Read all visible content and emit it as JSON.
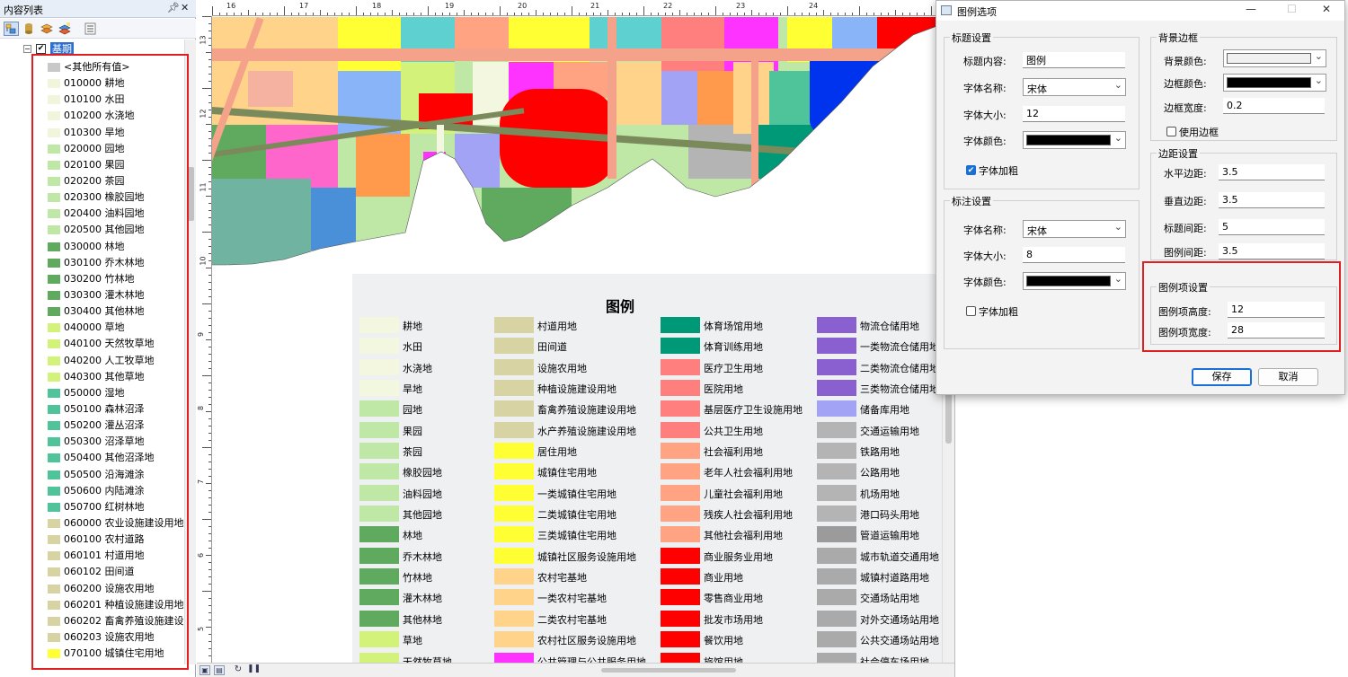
{
  "toc": {
    "title": "内容列表",
    "pin_icon": "pin-icon",
    "close_icon": "close-icon",
    "root_layer": "基期",
    "items": [
      {
        "label": "<其他所有值>",
        "color": "#c8c8c8"
      },
      {
        "label": "010000 耕地",
        "color": "#f0f5dc"
      },
      {
        "label": "010100 水田",
        "color": "#f0f5dc"
      },
      {
        "label": "010200 水浇地",
        "color": "#f0f5dc"
      },
      {
        "label": "010300 旱地",
        "color": "#f0f5dc"
      },
      {
        "label": "020000 园地",
        "color": "#bfe7a6"
      },
      {
        "label": "020100 果园",
        "color": "#bfe7a6"
      },
      {
        "label": "020200 茶园",
        "color": "#bfe7a6"
      },
      {
        "label": "020300 橡胶园地",
        "color": "#bfe7a6"
      },
      {
        "label": "020400 油料园地",
        "color": "#bfe7a6"
      },
      {
        "label": "020500 其他园地",
        "color": "#bfe7a6"
      },
      {
        "label": "030000 林地",
        "color": "#5faa5f"
      },
      {
        "label": "030100 乔木林地",
        "color": "#5faa5f"
      },
      {
        "label": "030200 竹林地",
        "color": "#5faa5f"
      },
      {
        "label": "030300 灌木林地",
        "color": "#5faa5f"
      },
      {
        "label": "030400 其他林地",
        "color": "#5faa5f"
      },
      {
        "label": "040000 草地",
        "color": "#d2f27a"
      },
      {
        "label": "040100 天然牧草地",
        "color": "#d2f27a"
      },
      {
        "label": "040200 人工牧草地",
        "color": "#d2f27a"
      },
      {
        "label": "040300 其他草地",
        "color": "#d2f27a"
      },
      {
        "label": "050000 湿地",
        "color": "#4fc49a"
      },
      {
        "label": "050100 森林沼泽",
        "color": "#4fc49a"
      },
      {
        "label": "050200 灌丛沼泽",
        "color": "#4fc49a"
      },
      {
        "label": "050300 沼泽草地",
        "color": "#4fc49a"
      },
      {
        "label": "050400 其他沼泽地",
        "color": "#4fc49a"
      },
      {
        "label": "050500 沿海滩涂",
        "color": "#4fc49a"
      },
      {
        "label": "050600 内陆滩涂",
        "color": "#4fc49a"
      },
      {
        "label": "050700 红树林地",
        "color": "#4fc49a"
      },
      {
        "label": "060000 农业设施建设用地",
        "color": "#d8d3a3"
      },
      {
        "label": "060100 农村道路",
        "color": "#d8d3a3"
      },
      {
        "label": "060101 村道用地",
        "color": "#d8d3a3"
      },
      {
        "label": "060102 田间道",
        "color": "#d8d3a3"
      },
      {
        "label": "060200 设施农用地",
        "color": "#d8d3a3"
      },
      {
        "label": "060201 种植设施建设用地",
        "color": "#d8d3a3"
      },
      {
        "label": "060202 畜禽养殖设施建设",
        "color": "#d8d3a3"
      },
      {
        "label": "060203 设施农用地",
        "color": "#d8d3a3"
      },
      {
        "label": "070100 城镇住宅用地",
        "color": "#ffff33"
      }
    ]
  },
  "ruler": {
    "top": [
      "16",
      "17",
      "18",
      "19",
      "20",
      "21",
      "22",
      "23",
      "24"
    ],
    "left": [
      "13",
      "12",
      "11",
      "10",
      "9",
      "8",
      "7",
      "6",
      "5"
    ]
  },
  "legend": {
    "title": "图例",
    "columns": [
      [
        {
          "label": "耕地",
          "color": "#f3f7e0"
        },
        {
          "label": "水田",
          "color": "#f3f7e0"
        },
        {
          "label": "水浇地",
          "color": "#f3f7e0"
        },
        {
          "label": "旱地",
          "color": "#f3f7e0"
        },
        {
          "label": "园地",
          "color": "#bfe7a6"
        },
        {
          "label": "果园",
          "color": "#bfe7a6"
        },
        {
          "label": "茶园",
          "color": "#bfe7a6"
        },
        {
          "label": "橡胶园地",
          "color": "#bfe7a6"
        },
        {
          "label": "油料园地",
          "color": "#bfe7a6"
        },
        {
          "label": "其他园地",
          "color": "#bfe7a6"
        },
        {
          "label": "林地",
          "color": "#5faa5f"
        },
        {
          "label": "乔木林地",
          "color": "#5faa5f"
        },
        {
          "label": "竹林地",
          "color": "#5faa5f"
        },
        {
          "label": "灌木林地",
          "color": "#5faa5f"
        },
        {
          "label": "其他林地",
          "color": "#5faa5f"
        },
        {
          "label": "草地",
          "color": "#d2f27a"
        },
        {
          "label": "天然牧草地",
          "color": "#d2f27a"
        }
      ],
      [
        {
          "label": "村道用地",
          "color": "#d8d3a3"
        },
        {
          "label": "田间道",
          "color": "#d8d3a3"
        },
        {
          "label": "设施农用地",
          "color": "#d8d3a3"
        },
        {
          "label": "种植设施建设用地",
          "color": "#d8d3a3"
        },
        {
          "label": "畜禽养殖设施建设用地",
          "color": "#d8d3a3"
        },
        {
          "label": "水产养殖设施建设用地",
          "color": "#d8d3a3"
        },
        {
          "label": "居住用地",
          "color": "#ffff33"
        },
        {
          "label": "城镇住宅用地",
          "color": "#ffff33"
        },
        {
          "label": "一类城镇住宅用地",
          "color": "#ffff33"
        },
        {
          "label": "二类城镇住宅用地",
          "color": "#ffff33"
        },
        {
          "label": "三类城镇住宅用地",
          "color": "#ffff33"
        },
        {
          "label": "城镇社区服务设施用地",
          "color": "#ffff33"
        },
        {
          "label": "农村宅基地",
          "color": "#ffd38a"
        },
        {
          "label": "一类农村宅基地",
          "color": "#ffd38a"
        },
        {
          "label": "二类农村宅基地",
          "color": "#ffd38a"
        },
        {
          "label": "农村社区服务设施用地",
          "color": "#ffd38a"
        },
        {
          "label": "公共管理与公共服务用地",
          "color": "#ff33ff"
        }
      ],
      [
        {
          "label": "体育场馆用地",
          "color": "#009977"
        },
        {
          "label": "体育训练用地",
          "color": "#009977"
        },
        {
          "label": "医疗卫生用地",
          "color": "#ff7f7f"
        },
        {
          "label": "医院用地",
          "color": "#ff7f7f"
        },
        {
          "label": "基层医疗卫生设施用地",
          "color": "#ff7f7f"
        },
        {
          "label": "公共卫生用地",
          "color": "#ff7f7f"
        },
        {
          "label": "社会福利用地",
          "color": "#ffa383"
        },
        {
          "label": "老年人社会福利用地",
          "color": "#ffa383"
        },
        {
          "label": "儿童社会福利用地",
          "color": "#ffa383"
        },
        {
          "label": "残疾人社会福利用地",
          "color": "#ffa383"
        },
        {
          "label": "其他社会福利用地",
          "color": "#ffa383"
        },
        {
          "label": "商业服务业用地",
          "color": "#ff0000"
        },
        {
          "label": "商业用地",
          "color": "#ff0000"
        },
        {
          "label": "零售商业用地",
          "color": "#ff0000"
        },
        {
          "label": "批发市场用地",
          "color": "#ff0000"
        },
        {
          "label": "餐饮用地",
          "color": "#ff0000"
        },
        {
          "label": "旅馆用地",
          "color": "#ff0000"
        }
      ],
      [
        {
          "label": "物流仓储用地",
          "color": "#8a5fd0"
        },
        {
          "label": "一类物流仓储用地",
          "color": "#8a5fd0"
        },
        {
          "label": "二类物流仓储用地",
          "color": "#8a5fd0"
        },
        {
          "label": "三类物流仓储用地",
          "color": "#8a5fd0"
        },
        {
          "label": "储备库用地",
          "color": "#a3a3f5"
        },
        {
          "label": "交通运输用地",
          "color": "#b4b4b4"
        },
        {
          "label": "铁路用地",
          "color": "#b4b4b4"
        },
        {
          "label": "公路用地",
          "color": "#b4b4b4"
        },
        {
          "label": "机场用地",
          "color": "#b4b4b4"
        },
        {
          "label": "港口码头用地",
          "color": "#b4b4b4"
        },
        {
          "label": "管道运输用地",
          "color": "#9b9b9b"
        },
        {
          "label": "城市轨道交通用地",
          "color": "#aaaaaa"
        },
        {
          "label": "城镇村道路用地",
          "color": "#aaaaaa"
        },
        {
          "label": "交通场站用地",
          "color": "#aaaaaa"
        },
        {
          "label": "对外交通场站用地",
          "color": "#aaaaaa"
        },
        {
          "label": "公共交通场站用地",
          "color": "#aaaaaa"
        },
        {
          "label": "社会停车场用地",
          "color": "#aaaaaa"
        }
      ]
    ]
  },
  "dialog": {
    "title": "图例选项",
    "title_group": {
      "label": "标题设置",
      "content_label": "标题内容:",
      "content_value": "图例",
      "font_name_label": "字体名称:",
      "font_name_value": "宋体",
      "font_size_label": "字体大小:",
      "font_size_value": "12",
      "font_color_label": "字体颜色:",
      "font_color": "#000000",
      "bold_label": "字体加粗",
      "bold_checked": true
    },
    "label_group": {
      "label": "标注设置",
      "font_name_label": "字体名称:",
      "font_name_value": "宋体",
      "font_size_label": "字体大小:",
      "font_size_value": "8",
      "font_color_label": "字体颜色:",
      "font_color": "#000000",
      "bold_label": "字体加粗",
      "bold_checked": false
    },
    "bg_group": {
      "label": "背景边框",
      "bg_color_label": "背景颜色:",
      "bg_color": "#f0f0f0",
      "border_color_label": "边框颜色:",
      "border_color": "#000000",
      "border_width_label": "边框宽度:",
      "border_width_value": "0.2",
      "use_border_label": "使用边框",
      "use_border_checked": false
    },
    "margin_group": {
      "label": "边距设置",
      "h_label": "水平边距:",
      "h_value": "3.5",
      "v_label": "垂直边距:",
      "v_value": "3.5",
      "title_gap_label": "标题间距:",
      "title_gap_value": "5",
      "item_gap_label": "图例间距:",
      "item_gap_value": "3.5"
    },
    "item_group": {
      "label": "图例项设置",
      "height_label": "图例项高度:",
      "height_value": "12",
      "width_label": "图例项宽度:",
      "width_value": "28"
    },
    "save_label": "保存",
    "cancel_label": "取消"
  }
}
